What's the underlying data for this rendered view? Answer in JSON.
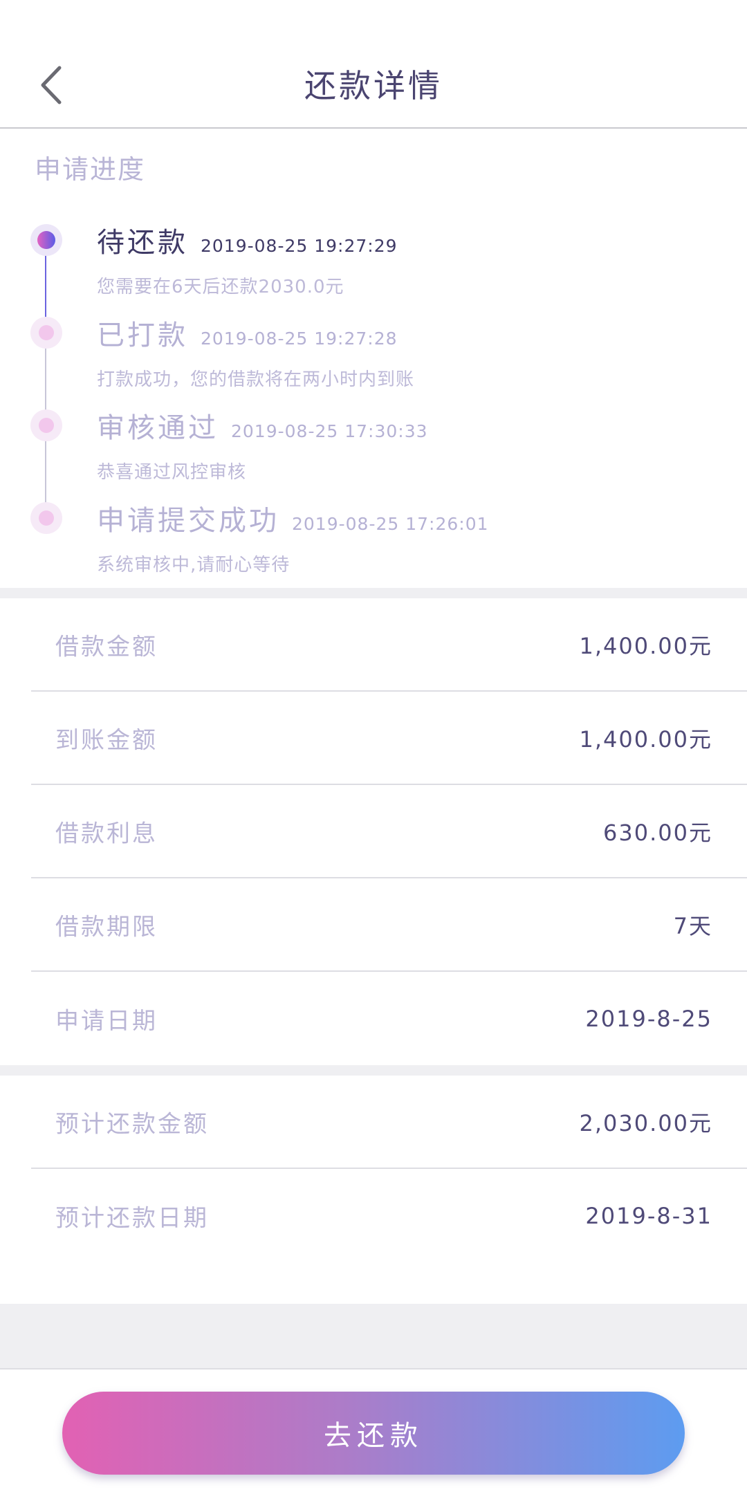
{
  "header": {
    "title": "还款详情"
  },
  "progress": {
    "title": "申请进度",
    "steps": [
      {
        "title": "待还款",
        "time": "2019-08-25 19:27:29",
        "desc": "您需要在6天后还款2030.0元"
      },
      {
        "title": "已打款",
        "time": "2019-08-25 19:27:28",
        "desc": "打款成功，您的借款将在两小时内到账"
      },
      {
        "title": "审核通过",
        "time": "2019-08-25 17:30:33",
        "desc": "恭喜通过风控审核"
      },
      {
        "title": "申请提交成功",
        "time": "2019-08-25 17:26:01",
        "desc": "系统审核中,请耐心等待"
      }
    ]
  },
  "loan": {
    "rows": [
      {
        "label": "借款金额",
        "value": "1,400.00元"
      },
      {
        "label": "到账金额",
        "value": "1,400.00元"
      },
      {
        "label": "借款利息",
        "value": "630.00元"
      },
      {
        "label": "借款期限",
        "value": "7天"
      },
      {
        "label": "申请日期",
        "value": "2019-8-25"
      }
    ]
  },
  "repay": {
    "rows": [
      {
        "label": "预计还款金额",
        "value": "2,030.00元"
      },
      {
        "label": "预计还款日期",
        "value": "2019-8-31"
      }
    ]
  },
  "footer": {
    "button_label": "去还款"
  },
  "colors": {
    "accent_start": "#e261b3",
    "accent_end": "#5d9cf0",
    "timeline_active": "#6b63e0"
  }
}
